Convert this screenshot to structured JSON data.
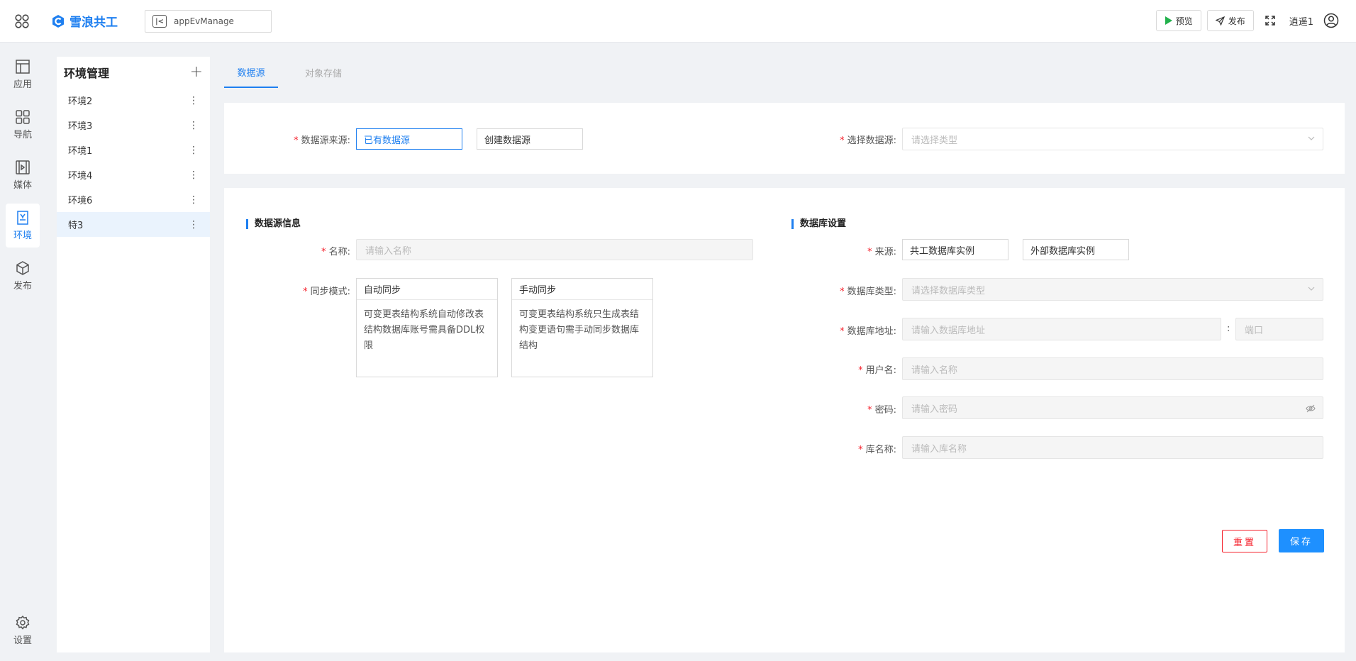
{
  "header": {
    "logo_text": "雪浪共工",
    "app_name": "appEvManage",
    "preview_label": "预览",
    "publish_label": "发布",
    "username": "逍遥1",
    "accent": "#1e7ff0"
  },
  "rail": {
    "items": [
      {
        "label": "应用",
        "icon": "layout-icon"
      },
      {
        "label": "导航",
        "icon": "grid-icon"
      },
      {
        "label": "媒体",
        "icon": "media-icon"
      },
      {
        "label": "环境",
        "icon": "env-icon",
        "active": true
      },
      {
        "label": "发布",
        "icon": "cube-icon"
      }
    ],
    "settings_label": "设置"
  },
  "sidebar": {
    "title": "环境管理",
    "items": [
      {
        "label": "环境2"
      },
      {
        "label": "环境3"
      },
      {
        "label": "环境1"
      },
      {
        "label": "环境4"
      },
      {
        "label": "环境6"
      },
      {
        "label": "特3",
        "active": true
      }
    ]
  },
  "tabs": [
    {
      "label": "数据源",
      "active": true
    },
    {
      "label": "对象存储"
    }
  ],
  "source": {
    "label": "数据源来源:",
    "option_existing": "已有数据源",
    "option_create": "创建数据源",
    "select_label": "选择数据源:",
    "select_placeholder": "请选择类型"
  },
  "info": {
    "section_title": "数据源信息",
    "name_label": "名称:",
    "name_placeholder": "请输入名称",
    "sync_label": "同步模式:",
    "auto": {
      "title": "自动同步",
      "desc": "可变更表结构系统自动修改表结构数据库账号需具备DDL权限"
    },
    "manual": {
      "title": "手动同步",
      "desc": "可变更表结构系统只生成表结构变更语句需手动同步数据库结构"
    }
  },
  "db": {
    "section_title": "数据库设置",
    "origin_label": "来源:",
    "origin_internal": "共工数据库实例",
    "origin_external": "外部数据库实例",
    "type_label": "数据库类型:",
    "type_placeholder": "请选择数据库类型",
    "addr_label": "数据库地址:",
    "addr_placeholder": "请输入数据库地址",
    "port_sep": ":",
    "port_placeholder": "端口",
    "user_label": "用户名:",
    "user_placeholder": "请输入名称",
    "pwd_label": "密码:",
    "pwd_placeholder": "请输入密码",
    "dbname_label": "库名称:",
    "dbname_placeholder": "请输入库名称"
  },
  "actions": {
    "reset_label": "重置",
    "save_label": "保存"
  }
}
